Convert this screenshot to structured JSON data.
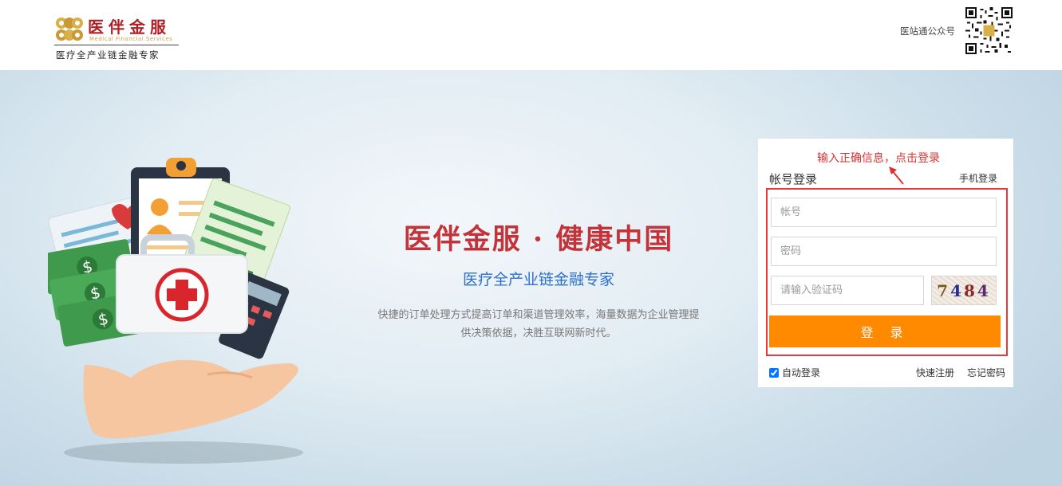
{
  "header": {
    "logo": {
      "name": "医伴金服",
      "english": "Medical Financial Services",
      "slogan": "医疗全产业链金融专家"
    },
    "qr_label": "医站通公众号"
  },
  "hero": {
    "title": "医伴金服 · 健康中国",
    "subtitle": "医疗全产业链金融专家",
    "description": "快捷的订单处理方式提高订单和渠道管理效率，海量数据为企业管理提供决策依据，决胜互联网新时代。"
  },
  "login": {
    "annotation": "输入正确信息，点击登录",
    "title": "帐号登录",
    "phone_login": "手机登录",
    "account_placeholder": "帐号",
    "password_placeholder": "密码",
    "captcha_placeholder": "请输入验证码",
    "captcha_code": [
      "7",
      "4",
      "8",
      "4"
    ],
    "submit": "登 录",
    "remember_label": "自动登录",
    "remember_checked": true,
    "register": "快速注册",
    "forgot": "忘记密码"
  },
  "colors": {
    "brand_red": "#c3343a",
    "accent_blue": "#2b6fce",
    "button_orange": "#ff8a00",
    "annotation_red": "#e23b3b"
  }
}
